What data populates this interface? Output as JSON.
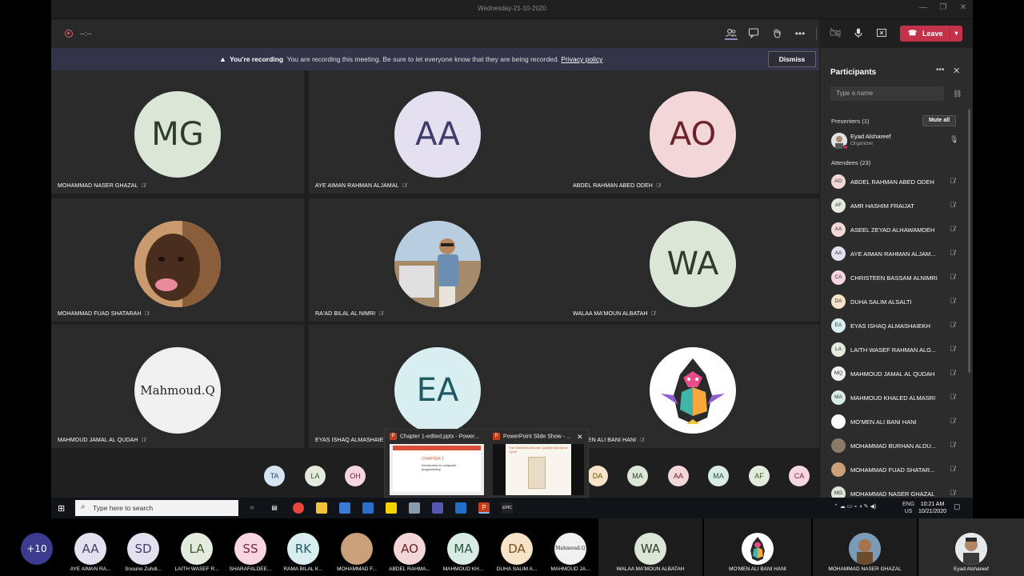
{
  "window": {
    "title": "Wednesday-21-10-2020",
    "controls": [
      "—",
      "❐",
      "✕"
    ]
  },
  "meeting": {
    "timer": "--:--",
    "leave_label": "Leave",
    "banner": {
      "title": "You're recording",
      "text": "You are recording this meeting. Be sure to let everyone know that they are being recorded.",
      "link": "Privacy policy",
      "dismiss": "Dismiss"
    }
  },
  "tiles": [
    {
      "initials": "MG",
      "name": "MOHAMMAD NASER GHAZAL",
      "bg": "#dbe6d7",
      "fg": "#2f3b2b"
    },
    {
      "initials": "AA",
      "name": "AYE AIMAN RAHMAN ALJAMAL",
      "bg": "#e4e0f0",
      "fg": "#3f3d6b"
    },
    {
      "initials": "AO",
      "name": "ABDEL RAHMAN ABED ODEH",
      "bg": "#f2d6d8",
      "fg": "#6b2228"
    },
    {
      "initials": "",
      "name": "MOHAMMAD FUAD SHATARAH",
      "bg": "#caa07a",
      "fg": "#333"
    },
    {
      "initials": "",
      "name": "RA'AD BILAL AL NIMRI",
      "bg": "#9fb8cc",
      "fg": "#333"
    },
    {
      "initials": "WA",
      "name": "WALAA MA'MOUN ALBATAH",
      "bg": "#dbe6d7",
      "fg": "#2f3b2b"
    },
    {
      "initials": "Mahmoud.Q",
      "name": "MAHMOUD JAMAL AL QUDAH",
      "bg": "#f0f0f0",
      "fg": "#222"
    },
    {
      "initials": "EA",
      "name": "EYAS ISHAQ ALMASHAIEKH",
      "bg": "#d8eef0",
      "fg": "#1f5a61"
    },
    {
      "initials": "",
      "name": "MO'MEN ALI BANI HANI",
      "bg": "#ffffff",
      "fg": "#333"
    }
  ],
  "mini_avatars": [
    {
      "initials": "TA",
      "bg": "#d7e4f2",
      "fg": "#2a4a6b"
    },
    {
      "initials": "LA",
      "bg": "#e3ecdc",
      "fg": "#3a5a2b"
    },
    {
      "initials": "OH",
      "bg": "#f7d6e0",
      "fg": "#7a2240"
    },
    {
      "initials": "DA",
      "bg": "#f6e3c8",
      "fg": "#7a4f14"
    },
    {
      "initials": "MA",
      "bg": "#dbe6d7",
      "fg": "#2f3b2b"
    },
    {
      "initials": "AA",
      "bg": "#f2d6d8",
      "fg": "#6b2228"
    },
    {
      "initials": "MA",
      "bg": "#d9ece4",
      "fg": "#24523f"
    },
    {
      "initials": "AF",
      "bg": "#e3ecdc",
      "fg": "#3a5a2b"
    },
    {
      "initials": "CA",
      "bg": "#f7d6e0",
      "fg": "#7a2240"
    }
  ],
  "popup": {
    "item1": "Chapter 1-edited.pptx - Power...",
    "item2": "PowerPoint Slide Show - ...",
    "slide_title": "CHAPTER 1",
    "slide_sub": "Introduction to computer programming",
    "slide2_title": "The Waterfall-Absolute Quality Assurance Cycle"
  },
  "participants": {
    "title": "Participants",
    "search_placeholder": "Type a name",
    "presenters_label": "Presenters (1)",
    "mute_all": "Mute all",
    "presenter": {
      "name": "Eyad Alshareef",
      "role": "Organizer"
    },
    "attendees_label": "Attendees (23)",
    "attendees": [
      {
        "initials": "AO",
        "name": "ABDEL RAHMAN ABED ODEH",
        "bg": "#f2d6d8"
      },
      {
        "initials": "AF",
        "name": "AMR HASHIM FRAIJAT",
        "bg": "#e3ecdc"
      },
      {
        "initials": "AA",
        "name": "ASEEL ZEYAD ALHAWAMDEH",
        "bg": "#f2d6d8"
      },
      {
        "initials": "AA",
        "name": "AYE AIMAN RAHMAN ALJAM...",
        "bg": "#e4e0f0"
      },
      {
        "initials": "CA",
        "name": "CHRISTEEN BASSAM ALNIMRI",
        "bg": "#f7d6e0"
      },
      {
        "initials": "DA",
        "name": "DUHA SALIM ALSALTI",
        "bg": "#f6e3c8"
      },
      {
        "initials": "EA",
        "name": "EYAS ISHAQ ALMASHAIEKH",
        "bg": "#d8eef0"
      },
      {
        "initials": "LA",
        "name": "LAITH WASEF RAHMAN ALG...",
        "bg": "#e3ecdc"
      },
      {
        "initials": "MQ",
        "name": "MAHMOUD JAMAL AL QUDAH",
        "bg": "#f0f0f0"
      },
      {
        "initials": "MA",
        "name": "MAHMOUD KHALED ALMASRI",
        "bg": "#d9ece4"
      },
      {
        "initials": "",
        "name": "MO'MEN ALI BANI HANI",
        "bg": "#ffffff"
      },
      {
        "initials": "",
        "name": "MOHAMMAD BURHAN ALDU...",
        "bg": "#8a7a6a"
      },
      {
        "initials": "",
        "name": "MOHAMMAD FUAD SHATAR...",
        "bg": "#caa07a"
      },
      {
        "initials": "MG",
        "name": "MOHAMMAD NASER GHAZAL",
        "bg": "#dbe6d7"
      }
    ]
  },
  "taskbar": {
    "search_placeholder": "Type here to search",
    "lang": "ENG",
    "region": "US",
    "time": "10:21 AM",
    "date": "10/21/2020"
  },
  "strip": [
    {
      "initials": "+10",
      "name": "",
      "bg": "#3b3b8f",
      "fg": "#ffffff"
    },
    {
      "initials": "AA",
      "name": "AYE AIMAN RA...",
      "bg": "#e4e0f0",
      "fg": "#3f3d6b"
    },
    {
      "initials": "SD",
      "name": "Snouno Zuhdi...",
      "bg": "#e4e0f0",
      "fg": "#3f3d6b"
    },
    {
      "initials": "LA",
      "name": "LAITH WASEF R...",
      "bg": "#e3ecdc",
      "fg": "#3a5a2b"
    },
    {
      "initials": "SS",
      "name": "SHARAFALDEE...",
      "bg": "#f7d6e0",
      "fg": "#7a2240"
    },
    {
      "initials": "RK",
      "name": "RAMA BILAL K...",
      "bg": "#d8eef0",
      "fg": "#1f5a61"
    },
    {
      "initials": "",
      "name": "MOHAMMAD F...",
      "bg": "#caa07a",
      "fg": "#333"
    },
    {
      "initials": "AO",
      "name": "ABDEL RAHMA...",
      "bg": "#f2d6d8",
      "fg": "#6b2228"
    },
    {
      "initials": "MA",
      "name": "MAHMOUD KH...",
      "bg": "#d9ece4",
      "fg": "#24523f"
    },
    {
      "initials": "DA",
      "name": "DUHA SALIM A...",
      "bg": "#f6e3c8",
      "fg": "#7a4f14"
    },
    {
      "initials": "Mahmoud.Q",
      "name": "MAHMOUD JA...",
      "bg": "#f0f0f0",
      "fg": "#222"
    }
  ],
  "strip_big": [
    {
      "initials": "WA",
      "name": "WALAA MA'MOUN ALBATAH"
    },
    {
      "initials": "",
      "name": "MO'MEN ALI BANI HANI"
    },
    {
      "initials": "",
      "name": "MOHAMMAD NASER GHAZAL"
    },
    {
      "initials": "",
      "name": "Eyad Alshareef"
    }
  ]
}
